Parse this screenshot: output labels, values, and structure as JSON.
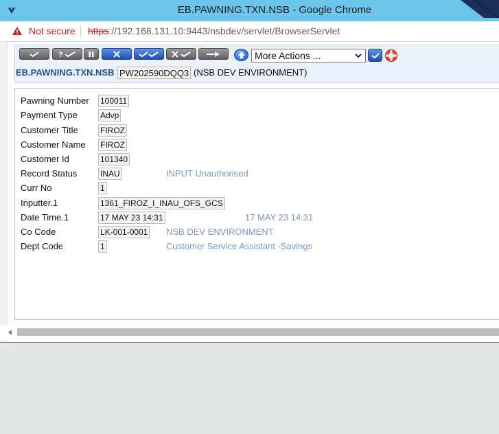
{
  "window": {
    "title": "EB.PAWNING.TXN.NSB - Google Chrome"
  },
  "addressbar": {
    "security_label": "Not secure",
    "url_scheme": "https",
    "url_rest": "://192.168.131.10:9443/nsbdev/servlet/BrowserServlet"
  },
  "toolbar": {
    "buttons": [
      {
        "icon": "commit-check-icon"
      },
      {
        "icon": "validate-icon"
      },
      {
        "icon": "hold-icon"
      },
      {
        "icon": "delete-icon"
      },
      {
        "icon": "authorise-icon"
      },
      {
        "icon": "reverse-icon"
      },
      {
        "icon": "next-icon"
      },
      {
        "icon": "up-arrow-icon"
      }
    ],
    "actions_select": "More Actions ...",
    "go_icon": "go-check-icon",
    "help_icon": "lifebuoy-icon"
  },
  "header": {
    "application": "EB.PAWNING.TXN.NSB",
    "record_id": "PW202590DQQ3",
    "environment": "(NSB DEV ENVIRONMENT)"
  },
  "form": {
    "fields": [
      {
        "label": "Pawning Number",
        "value": "100011",
        "enrichment": ""
      },
      {
        "label": "Payment Type",
        "value": "Advp",
        "enrichment": ""
      },
      {
        "label": "Customer Title",
        "value": "FIROZ",
        "enrichment": ""
      },
      {
        "label": "Customer Name",
        "value": "FIROZ",
        "enrichment": ""
      },
      {
        "label": "Customer Id",
        "value": "101340",
        "enrichment": ""
      },
      {
        "label": "Record Status",
        "value": "INAU",
        "enrichment": "INPUT Unauthorised"
      },
      {
        "label": "Curr No",
        "value": "1",
        "enrichment": ""
      },
      {
        "label": "Inputter.1",
        "value": "1361_FIROZ_I_INAU_OFS_GCS",
        "enrichment": ""
      },
      {
        "label": "Date Time.1",
        "value": "17 MAY 23 14:31",
        "enrichment": "17 MAY 23 14:31"
      },
      {
        "label": "Co Code",
        "value": "LK-001-0001",
        "enrichment": "NSB DEV ENVIRONMENT"
      },
      {
        "label": "Dept Code",
        "value": "1",
        "enrichment": "Customer Service Assistant -Savings"
      }
    ]
  },
  "colors": {
    "titlebar": "#6cc6ec",
    "not_secure": "#c5221f",
    "app_name": "#2c4f8a",
    "enrichment": "#7d96b8"
  }
}
